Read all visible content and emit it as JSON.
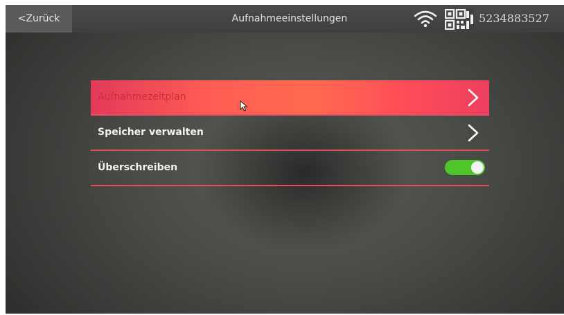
{
  "header": {
    "back_label": "<Zurück",
    "title": "Aufnahmeeinstellungen",
    "device_id": "5234883527",
    "icons": [
      "wifi-icon",
      "qr-code-icon"
    ]
  },
  "menu": {
    "items": [
      {
        "label": "Aufnahmezeitplan",
        "control": "chevron-right-icon",
        "selected": true
      },
      {
        "label": "Speicher verwalten",
        "control": "chevron-right-icon",
        "selected": false
      },
      {
        "label": "Überschreiben",
        "control": "toggle",
        "toggle_state": "on",
        "selected": false
      }
    ]
  },
  "colors": {
    "accent": "#ff5c54",
    "divider": "#e2505c",
    "toggle_on": "#4fc52b"
  }
}
